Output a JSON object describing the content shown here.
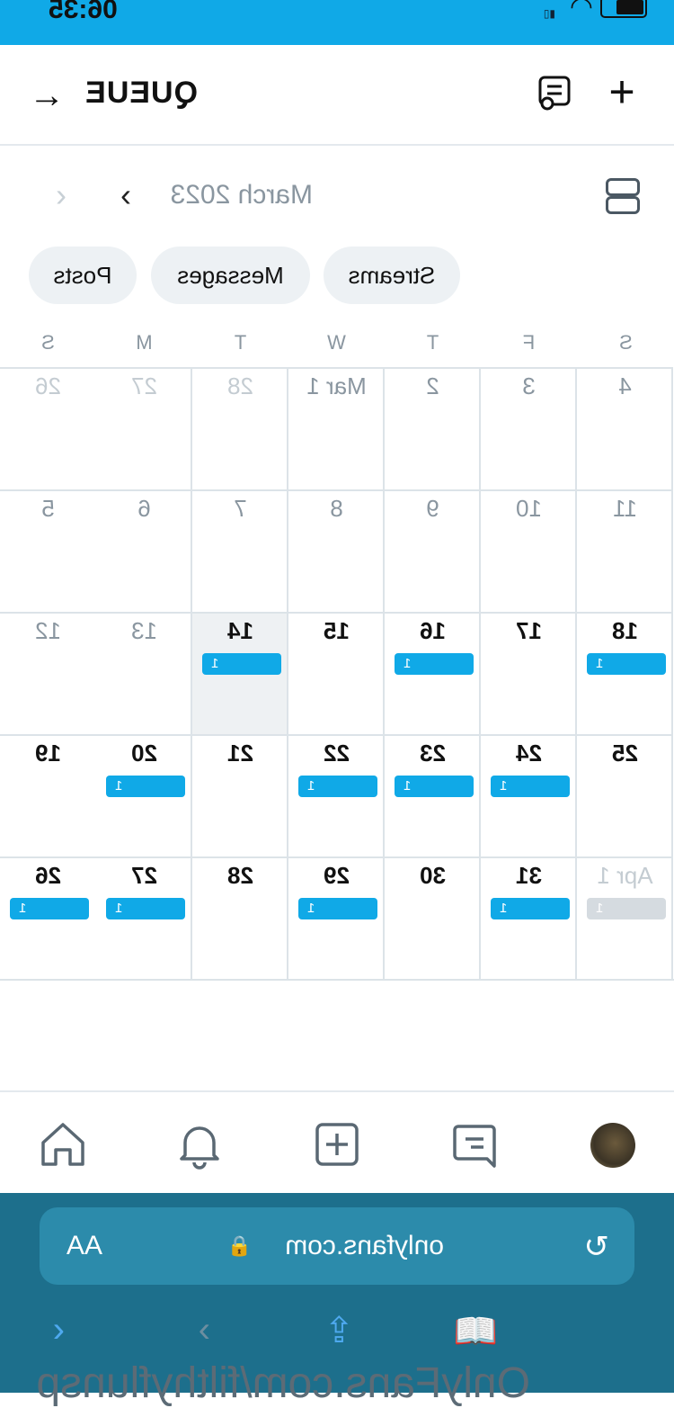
{
  "status_bar": {
    "time": "06:35"
  },
  "header": {
    "title": "QUEUE",
    "add_icon": "plus-icon",
    "list_icon": "list-icon",
    "back_icon": "arrow-left-icon"
  },
  "calendar": {
    "month": "March 2023",
    "tabs": [
      "Posts",
      "Messages",
      "Streams"
    ],
    "weekdays": [
      "S",
      "M",
      "T",
      "W",
      "T",
      "F",
      "S"
    ],
    "weeks": [
      [
        {
          "day": "26",
          "state": "muted"
        },
        {
          "day": "27",
          "state": "muted"
        },
        {
          "day": "28",
          "state": "muted"
        },
        {
          "day": "Mar 1",
          "state": "past"
        },
        {
          "day": "2",
          "state": "past"
        },
        {
          "day": "3",
          "state": "past"
        },
        {
          "day": "4",
          "state": "past"
        }
      ],
      [
        {
          "day": "5",
          "state": "past"
        },
        {
          "day": "6",
          "state": "past"
        },
        {
          "day": "7",
          "state": "past"
        },
        {
          "day": "8",
          "state": "past"
        },
        {
          "day": "9",
          "state": "past"
        },
        {
          "day": "10",
          "state": "past"
        },
        {
          "day": "11",
          "state": "past"
        }
      ],
      [
        {
          "day": "12",
          "state": "past"
        },
        {
          "day": "13",
          "state": "past"
        },
        {
          "day": "14",
          "state": "today",
          "count": "1"
        },
        {
          "day": "15",
          "state": "normal"
        },
        {
          "day": "16",
          "state": "normal",
          "count": "1"
        },
        {
          "day": "17",
          "state": "normal"
        },
        {
          "day": "18",
          "state": "normal",
          "count": "1"
        }
      ],
      [
        {
          "day": "19",
          "state": "normal"
        },
        {
          "day": "20",
          "state": "normal",
          "count": "1"
        },
        {
          "day": "21",
          "state": "normal"
        },
        {
          "day": "22",
          "state": "normal",
          "count": "1"
        },
        {
          "day": "23",
          "state": "normal",
          "count": "1"
        },
        {
          "day": "24",
          "state": "normal",
          "count": "1"
        },
        {
          "day": "25",
          "state": "normal"
        }
      ],
      [
        {
          "day": "26",
          "state": "normal",
          "count": "1"
        },
        {
          "day": "27",
          "state": "normal",
          "count": "1"
        },
        {
          "day": "28",
          "state": "normal"
        },
        {
          "day": "29",
          "state": "normal",
          "count": "1"
        },
        {
          "day": "30",
          "state": "normal"
        },
        {
          "day": "31",
          "state": "normal",
          "count": "1"
        },
        {
          "day": "Apr 1",
          "state": "muted",
          "count": "1"
        }
      ]
    ]
  },
  "bottom_nav": {
    "items": [
      {
        "name": "home-icon"
      },
      {
        "name": "bell-icon"
      },
      {
        "name": "add-post-icon"
      },
      {
        "name": "messages-icon"
      },
      {
        "name": "avatar"
      }
    ]
  },
  "browser": {
    "aa": "AA",
    "url": "onlyfans.com",
    "footer_url": "OnlyFans.com/filthyflunsp"
  },
  "colors": {
    "accent": "#10a9e7",
    "browser_bg": "#1d6f8c"
  }
}
